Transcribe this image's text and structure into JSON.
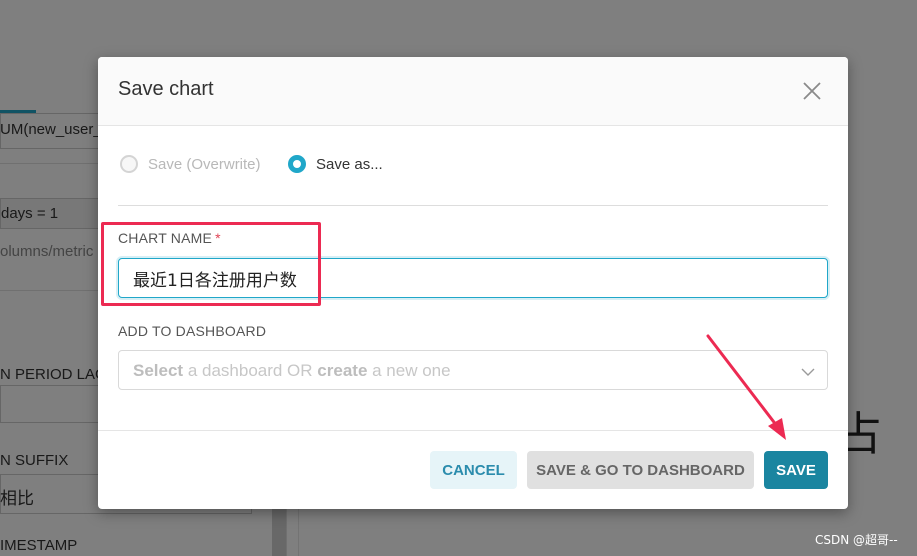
{
  "background": {
    "rows": [
      "UM(new_user_",
      "days = 1",
      "olumns/metric",
      "N PERIOD LAG",
      "N SUFFIX",
      "相比",
      "IMESTAMP"
    ],
    "glyph": "占"
  },
  "modal": {
    "title": "Save chart",
    "radio_overwrite": "Save (Overwrite)",
    "radio_save_as": "Save as...",
    "chart_name_label": "CHART NAME",
    "required_mark": "*",
    "chart_name_value": "最近1日各注册用户数",
    "dashboard_label": "ADD TO DASHBOARD",
    "dashboard_placeholder": {
      "p1": "Select",
      "p2": " a dashboard OR ",
      "p3": "create",
      "p4": " a new one"
    },
    "buttons": {
      "cancel": "CANCEL",
      "save_go": "SAVE & GO TO DASHBOARD",
      "save": "SAVE"
    }
  },
  "colors": {
    "accent": "#20a7c9",
    "save_button": "#1a85a0",
    "annotation": "#ec2a52"
  },
  "watermark": "CSDN @超哥--"
}
